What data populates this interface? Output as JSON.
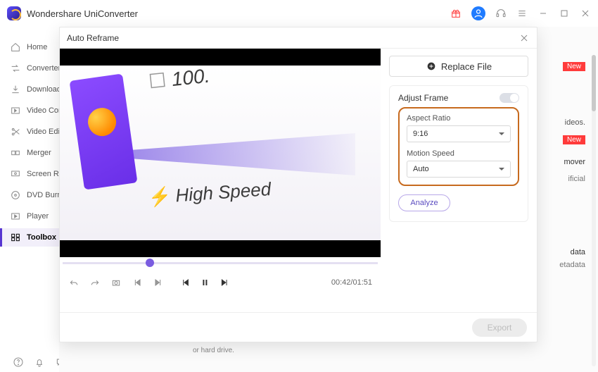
{
  "app": {
    "title": "Wondershare UniConverter"
  },
  "titlebar": {
    "gift_icon": "gift",
    "user_icon": "user",
    "support_icon": "headset",
    "menu_icon": "menu"
  },
  "sidebar": {
    "items": [
      {
        "label": "Home"
      },
      {
        "label": "Converter"
      },
      {
        "label": "Downloader"
      },
      {
        "label": "Video Compressor"
      },
      {
        "label": "Video Editor"
      },
      {
        "label": "Merger"
      },
      {
        "label": "Screen Recorder"
      },
      {
        "label": "DVD Burner"
      },
      {
        "label": "Player"
      },
      {
        "label": "Toolbox"
      }
    ]
  },
  "background": {
    "badge_new": "New",
    "text_ideos": "ideos.",
    "text_mover": "mover",
    "text_ificial": "ificial",
    "text_data": "data",
    "text_etadata": "etadata",
    "bottom_hint": "or hard drive."
  },
  "dialog": {
    "title": "Auto Reframe",
    "replace_label": "Replace File",
    "adjust_frame_label": "Adjust Frame",
    "aspect_ratio_label": "Aspect Ratio",
    "aspect_ratio_value": "9:16",
    "motion_speed_label": "Motion Speed",
    "motion_speed_value": "Auto",
    "analyze_label": "Analyze",
    "export_label": "Export",
    "time": "00:42/01:51",
    "video_text_top": "100.",
    "video_text_bottom": "High Speed"
  }
}
